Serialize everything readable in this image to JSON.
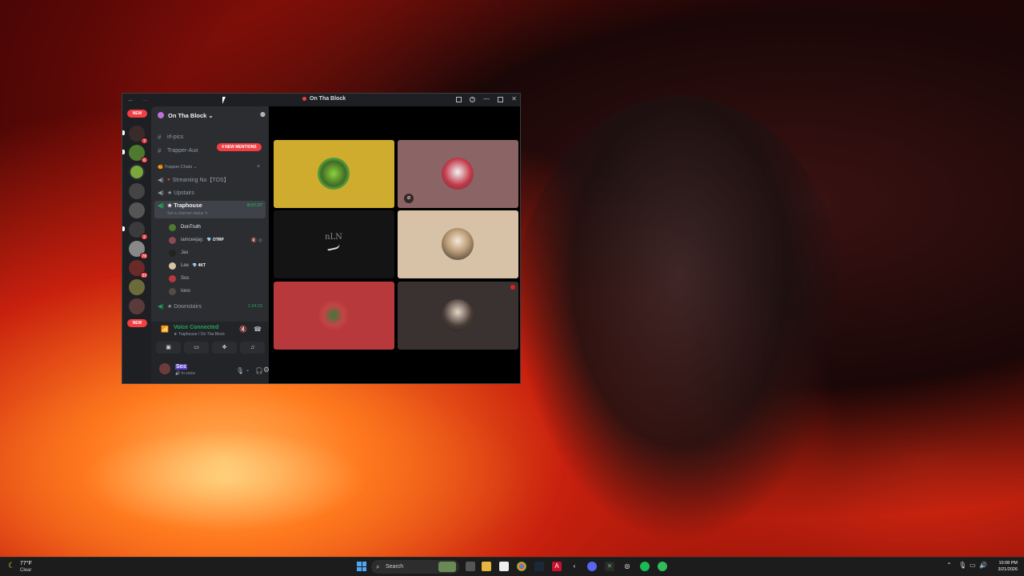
{
  "window": {
    "title": "On Tha Block",
    "back": "←",
    "forward": "→"
  },
  "rail": {
    "new_top": "NEW",
    "new_bottom": "NEW",
    "badges": [
      "7",
      "6",
      "2",
      "78",
      "33"
    ]
  },
  "server": {
    "name": "On Tha Block ⌄",
    "mentions": "4 NEW MENTIONS",
    "channels": {
      "irl": "irl-pics",
      "trapper_aux": "Trapper-Aux",
      "category": "Trapper Chats",
      "streaming": "Streaming No【TOS】",
      "upstairs": "★ Upstairs",
      "traphouse": "★ Traphouse",
      "traphouse_time": "8:07:27",
      "traphouse_status": "Set a channel status ✎",
      "downstairs": "★ Downstairs",
      "downstairs_time": "1:34:23"
    },
    "users": [
      {
        "name": "DonTruth",
        "tag": ""
      },
      {
        "name": "iamceejay.",
        "tag": "💎 OTRP"
      },
      {
        "name": "Jax",
        "tag": ""
      },
      {
        "name": "Lee",
        "tag": "💎 4KT"
      },
      {
        "name": "Sos",
        "tag": ""
      },
      {
        "name": "Iono",
        "tag": ""
      }
    ]
  },
  "voice": {
    "title": "Voice Connected",
    "sub": "★ Traphouse / On Tha Block",
    "me_name": "Sos",
    "me_state": "🔊 In voice"
  },
  "tiles": {
    "nike_text": "nLN"
  },
  "colors": {
    "tile_yellow": "#cfac2e",
    "tile_mauve": "#8b6465",
    "tile_black": "#141414",
    "tile_beige": "#d7c1a7",
    "tile_red": "#b8393b",
    "tile_brown": "#3a3230",
    "accent_green": "#23a559",
    "alert_red": "#f23f43"
  },
  "taskbar": {
    "temp": "77°F",
    "condition": "Clear",
    "search": "Search",
    "time": "10:08 PM",
    "date": "3/21/2026"
  }
}
